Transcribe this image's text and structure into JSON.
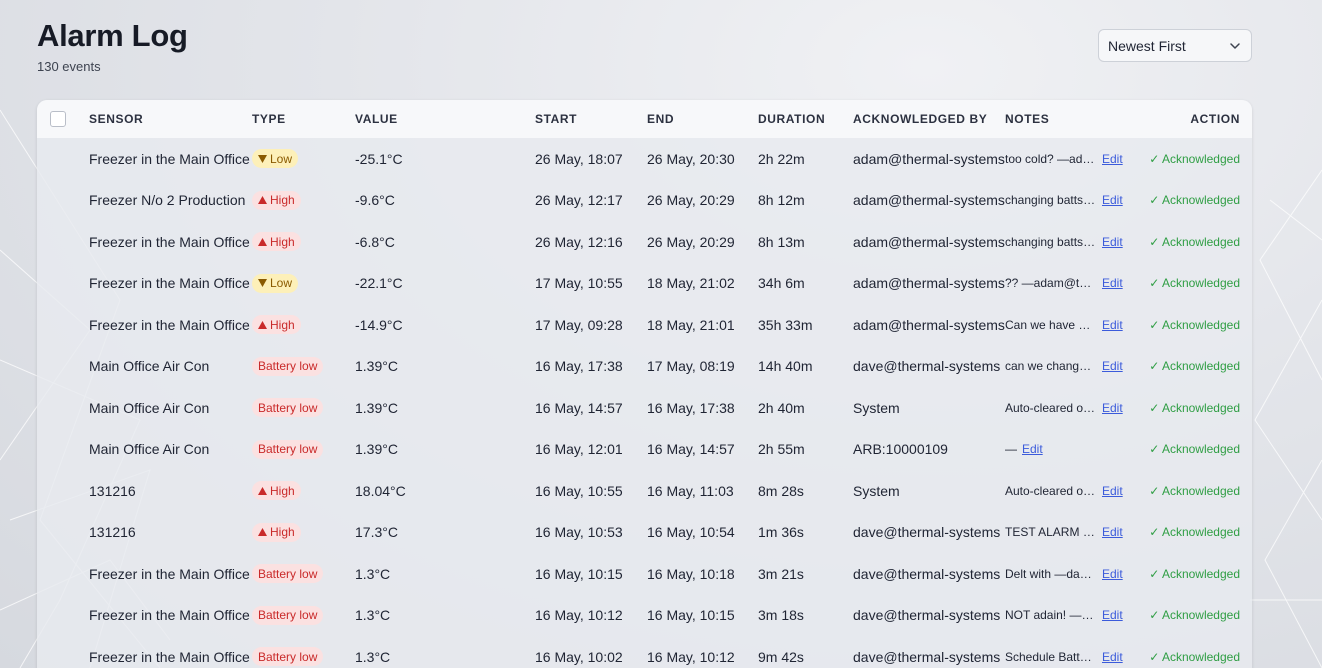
{
  "page": {
    "title": "Alarm Log",
    "event_count": "130 events"
  },
  "sort": {
    "selected": "Newest First"
  },
  "table": {
    "columns": [
      "SENSOR",
      "TYPE",
      "VALUE",
      "START",
      "END",
      "DURATION",
      "ACKNOWLEDGED BY",
      "NOTES",
      "ACTION"
    ],
    "edit_label": "Edit",
    "rows": [
      {
        "sensor": "Freezer in the Main Office",
        "type": "Low",
        "type_kind": "low",
        "value": "-25.1°C",
        "start": "26 May, 18:07",
        "end": "26 May, 20:30",
        "duration": "2h 22m",
        "ack_by": "adam@thermal-systems",
        "notes": "too cold? —adam@thermal",
        "action": "✓ Acknowledged"
      },
      {
        "sensor": "Freezer N/o 2 Production",
        "type": "High",
        "type_kind": "high",
        "value": "-9.6°C",
        "start": "26 May, 12:17",
        "end": "26 May, 20:29",
        "duration": "8h 12m",
        "ack_by": "adam@thermal-systems",
        "notes": "changing batts —adam",
        "action": "✓ Acknowledged"
      },
      {
        "sensor": "Freezer in the Main Office",
        "type": "High",
        "type_kind": "high",
        "value": "-6.8°C",
        "start": "26 May, 12:16",
        "end": "26 May, 20:29",
        "duration": "8h 13m",
        "ack_by": "adam@thermal-systems",
        "notes": "changing batts —adam",
        "action": "✓ Acknowledged"
      },
      {
        "sensor": "Freezer in the Main Office",
        "type": "Low",
        "type_kind": "low",
        "value": "-22.1°C",
        "start": "17 May, 10:55",
        "end": "18 May, 21:02",
        "duration": "34h 6m",
        "ack_by": "adam@thermal-systems",
        "notes": "?? —adam@thermal",
        "action": "✓ Acknowledged"
      },
      {
        "sensor": "Freezer in the Main Office",
        "type": "High",
        "type_kind": "high",
        "value": "-14.9°C",
        "start": "17 May, 09:28",
        "end": "18 May, 21:01",
        "duration": "35h 33m",
        "ack_by": "adam@thermal-systems",
        "notes": "Can we have a sensor",
        "action": "✓ Acknowledged"
      },
      {
        "sensor": "Main Office Air Con",
        "type": "Battery low",
        "type_kind": "battery",
        "value": "1.39°C",
        "start": "16 May, 17:38",
        "end": "17 May, 08:19",
        "duration": "14h 40m",
        "ack_by": "dave@thermal-systems",
        "notes": "can we change the batt",
        "action": "✓ Acknowledged"
      },
      {
        "sensor": "Main Office Air Con",
        "type": "Battery low",
        "type_kind": "battery",
        "value": "1.39°C",
        "start": "16 May, 14:57",
        "end": "16 May, 17:38",
        "duration": "2h 40m",
        "ack_by": "System",
        "notes": "Auto-cleared on recovery",
        "action": "✓ Acknowledged"
      },
      {
        "sensor": "Main Office Air Con",
        "type": "Battery low",
        "type_kind": "battery",
        "value": "1.39°C",
        "start": "16 May, 12:01",
        "end": "16 May, 14:57",
        "duration": "2h 55m",
        "ack_by": "ARB:10000109",
        "notes": "—",
        "action": "✓ Acknowledged"
      },
      {
        "sensor": "131216",
        "type": "High",
        "type_kind": "high",
        "value": "18.04°C",
        "start": "16 May, 10:55",
        "end": "16 May, 11:03",
        "duration": "8m 28s",
        "ack_by": "System",
        "notes": "Auto-cleared on recovery",
        "action": "✓ Acknowledged"
      },
      {
        "sensor": "131216",
        "type": "High",
        "type_kind": "high",
        "value": "17.3°C",
        "start": "16 May, 10:53",
        "end": "16 May, 10:54",
        "duration": "1m 36s",
        "ack_by": "dave@thermal-systems",
        "notes": "TEST ALARM —dave",
        "action": "✓ Acknowledged"
      },
      {
        "sensor": "Freezer in the Main Office",
        "type": "Battery low",
        "type_kind": "battery",
        "value": "1.3°C",
        "start": "16 May, 10:15",
        "end": "16 May, 10:18",
        "duration": "3m 21s",
        "ack_by": "dave@thermal-systems",
        "notes": "Delt with —dave@thermal",
        "action": "✓ Acknowledged"
      },
      {
        "sensor": "Freezer in the Main Office",
        "type": "Battery low",
        "type_kind": "battery",
        "value": "1.3°C",
        "start": "16 May, 10:12",
        "end": "16 May, 10:15",
        "duration": "3m 18s",
        "ack_by": "dave@thermal-systems",
        "notes": "NOT adain! —dave",
        "action": "✓ Acknowledged"
      },
      {
        "sensor": "Freezer in the Main Office",
        "type": "Battery low",
        "type_kind": "battery",
        "value": "1.3°C",
        "start": "16 May, 10:02",
        "end": "16 May, 10:12",
        "duration": "9m 42s",
        "ack_by": "dave@thermal-systems",
        "notes": "Schedule Battery change",
        "action": "✓ Acknowledged"
      }
    ]
  },
  "colors": {
    "acknowledged": "#2f9e44",
    "link": "#3b5bdb",
    "low_badge_bg": "#fdf0b9",
    "high_badge_bg": "#fbe1e1"
  }
}
